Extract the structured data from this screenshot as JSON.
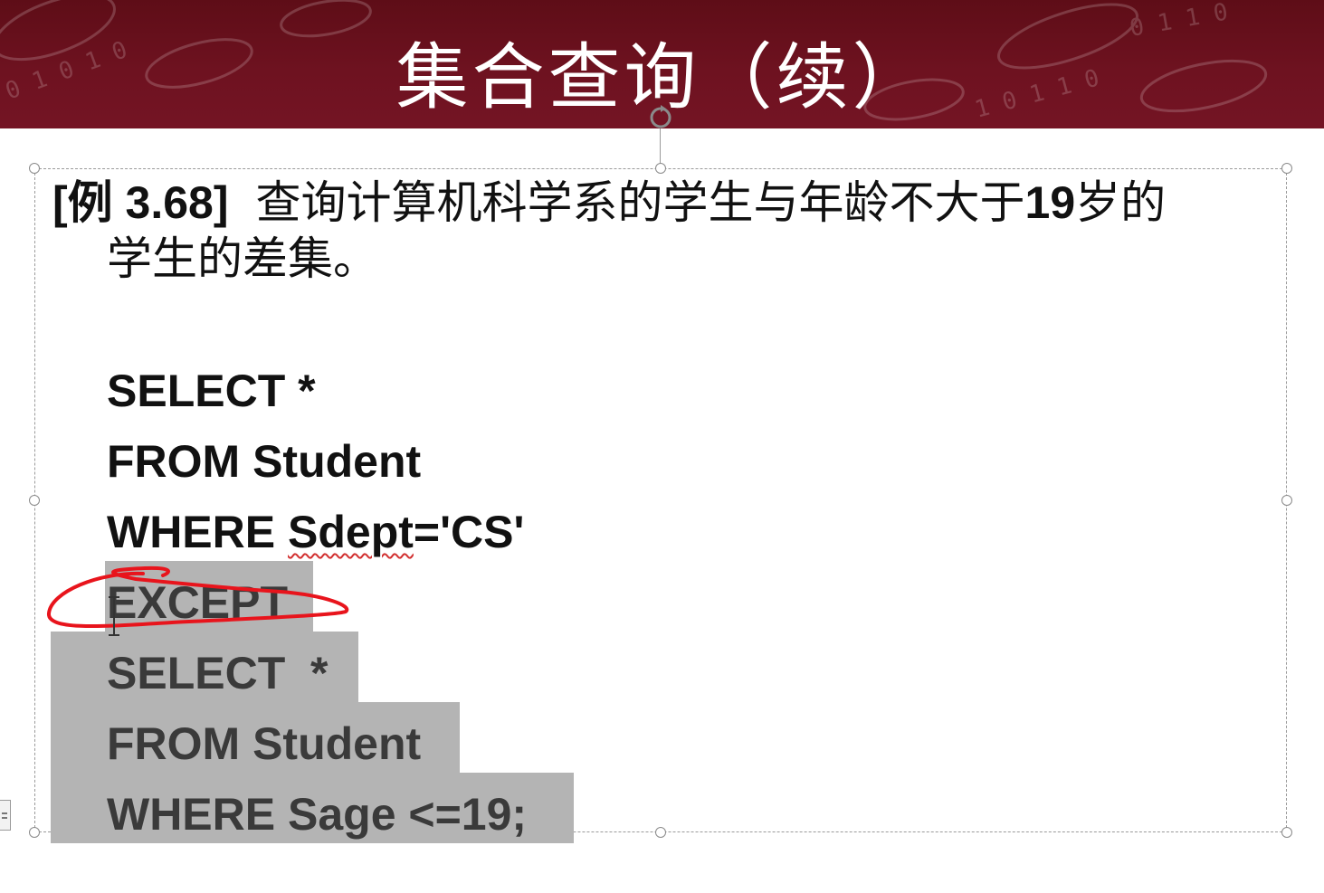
{
  "slide": {
    "title": "集合查询（续）"
  },
  "example": {
    "tag": "[例 3.68]",
    "line1_a": "查询计算机科学系的学生与年龄不大于",
    "line1_num": "19",
    "line1_b": "岁的",
    "line2": "学生的差集。"
  },
  "sql": {
    "lines": [
      "SELECT *",
      "FROM Student",
      "WHERE ",
      "EXCEPT",
      "SELECT  *",
      "FROM Student",
      "WHERE Sage <=19;"
    ],
    "sdept_word": "Sdept",
    "sdept_rest": "='CS'"
  },
  "colors": {
    "banner": "#6e1220",
    "selection": "#b4b4b4",
    "ink_annotation": "#e8141c"
  },
  "icons": {
    "rotate_handle": "rotate-icon",
    "text_cursor": "i-beam-cursor-icon",
    "side_panel": "notes-panel-icon"
  }
}
